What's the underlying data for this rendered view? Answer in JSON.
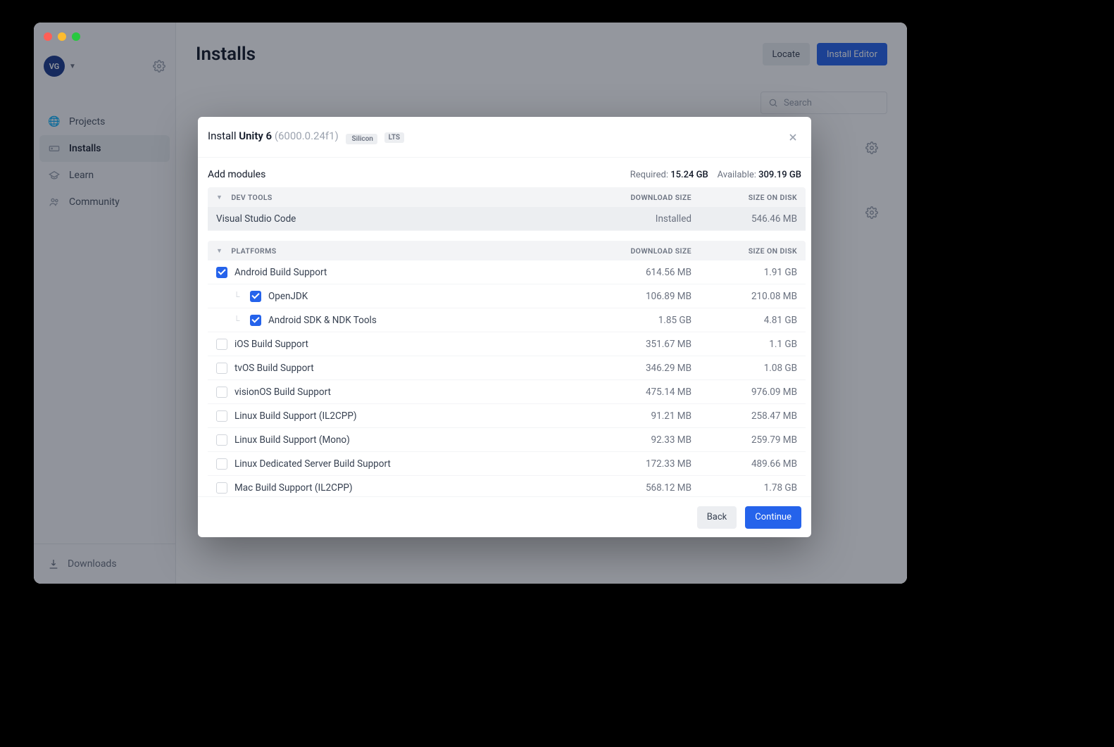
{
  "sidebar": {
    "avatar": "VG",
    "items": [
      {
        "label": "Projects"
      },
      {
        "label": "Installs"
      },
      {
        "label": "Learn"
      },
      {
        "label": "Community"
      }
    ],
    "downloads": "Downloads"
  },
  "main": {
    "title": "Installs",
    "locate": "Locate",
    "install_editor": "Install Editor",
    "search_placeholder": "Search"
  },
  "modal": {
    "title_prefix": "Install ",
    "title_bold": "Unity 6",
    "version": "(6000.0.24f1)",
    "badge_silicon": "Silicon",
    "badge_lts": "LTS",
    "add_modules": "Add modules",
    "required_label": "Required: ",
    "required_value": "15.24 GB",
    "available_label": "Available: ",
    "available_value": "309.19 GB",
    "columns": {
      "name_dev": "DEV TOOLS",
      "name_plat": "PLATFORMS",
      "dl": "DOWNLOAD SIZE",
      "disk": "SIZE ON DISK"
    },
    "devtools": [
      {
        "name": "Visual Studio Code",
        "installed_label": "Installed",
        "disk": "546.46 MB"
      }
    ],
    "platforms": [
      {
        "name": "Android Build Support",
        "dl": "614.56 MB",
        "disk": "1.91 GB",
        "checked": true
      },
      {
        "name": "OpenJDK",
        "dl": "106.89 MB",
        "disk": "210.08 MB",
        "checked": true,
        "child": true
      },
      {
        "name": "Android SDK & NDK Tools",
        "dl": "1.85 GB",
        "disk": "4.81 GB",
        "checked": true,
        "child": true
      },
      {
        "name": "iOS Build Support",
        "dl": "351.67 MB",
        "disk": "1.1 GB"
      },
      {
        "name": "tvOS Build Support",
        "dl": "346.29 MB",
        "disk": "1.08 GB"
      },
      {
        "name": "visionOS Build Support",
        "dl": "475.14 MB",
        "disk": "976.09 MB"
      },
      {
        "name": "Linux Build Support (IL2CPP)",
        "dl": "91.21 MB",
        "disk": "258.47 MB"
      },
      {
        "name": "Linux Build Support (Mono)",
        "dl": "92.33 MB",
        "disk": "259.79 MB"
      },
      {
        "name": "Linux Dedicated Server Build Support",
        "dl": "172.33 MB",
        "disk": "489.66 MB"
      },
      {
        "name": "Mac Build Support (IL2CPP)",
        "dl": "568.12 MB",
        "disk": "1.78 GB"
      }
    ],
    "back": "Back",
    "continue": "Continue"
  }
}
